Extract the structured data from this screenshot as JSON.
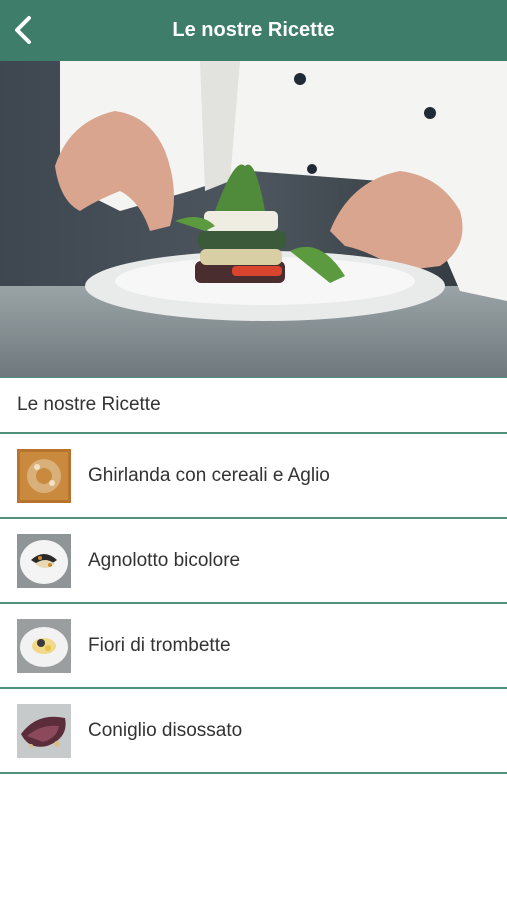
{
  "header": {
    "title": "Le nostre Ricette",
    "back_icon": "chevron-left-icon",
    "background_color": "#3d7d6a"
  },
  "hero": {
    "image": "chef-plating-dish-photo"
  },
  "section": {
    "title": "Le nostre Ricette"
  },
  "recipes": [
    {
      "label": "Ghirlanda con cereali e Aglio",
      "thumbnail": "ghirlanda-photo"
    },
    {
      "label": "Agnolotto bicolore",
      "thumbnail": "agnolotto-photo"
    },
    {
      "label": "Fiori di trombette",
      "thumbnail": "fiori-photo"
    },
    {
      "label": "Coniglio disossato",
      "thumbnail": "coniglio-photo"
    }
  ],
  "colors": {
    "accent": "#3d7d6a",
    "divider": "#4f8f7c",
    "text": "#333333"
  }
}
